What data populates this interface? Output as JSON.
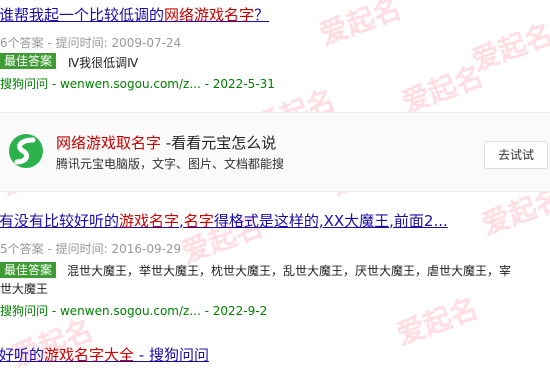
{
  "results": [
    {
      "title_pre": "谁帮我起一个比较低调的",
      "title_hl": "网络游戏名字",
      "title_post": "？",
      "meta": "6个答案 - 提问时间: 2009-07-24",
      "badge": "最佳答案",
      "answer": "Ⅳ我很低调Ⅳ",
      "answer_cont": "",
      "source": "搜狗问问",
      "url": " - wenwen.sogou.com/z...",
      "date": " - 2022-5-31"
    },
    {
      "title_pre": "有没有比较好听的",
      "title_hl": "游戏名字",
      "title_mid": ",",
      "title_hl2": "名字",
      "title_post": "得格式是这样的,XX大魔王,前面2...",
      "meta": "5个答案 - 提问时间: 2016-09-29",
      "badge": "最佳答案",
      "answer": "混世大魔王，举世大魔王，枕世大魔王，乱世大魔王，厌世大魔王，虐世大魔王，宰",
      "answer_cont": "世大魔王",
      "source": "搜狗问问",
      "url": " - wenwen.sogou.com/z...",
      "date": " - 2022-9-2"
    },
    {
      "title_pre": "好听的",
      "title_hl": "游戏名字大全",
      "title_post": " - 搜狗问问"
    }
  ],
  "card": {
    "title_hl": "网络游戏取名字",
    "title_post": " -看看元宝怎么说",
    "desc": "腾讯元宝电脑版，文字、图片、文档都能搜",
    "button": "去试试"
  },
  "watermark": "爱起名",
  "colors": {
    "link": "#1a0dab",
    "highlight": "#c00000",
    "source": "#008000",
    "badge": "#3f9c35"
  }
}
